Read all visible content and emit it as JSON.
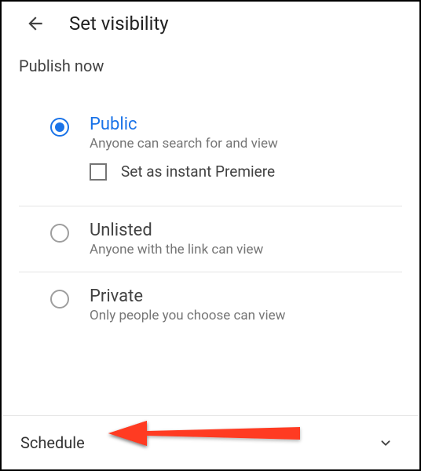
{
  "header": {
    "title": "Set visibility"
  },
  "section": {
    "label": "Publish now"
  },
  "options": [
    {
      "title": "Public",
      "desc": "Anyone can search for and view",
      "selected": true,
      "checkbox_label": "Set as instant Premiere"
    },
    {
      "title": "Unlisted",
      "desc": "Anyone with the link can view",
      "selected": false
    },
    {
      "title": "Private",
      "desc": "Only people you choose can view",
      "selected": false
    }
  ],
  "bottom": {
    "label": "Schedule"
  }
}
